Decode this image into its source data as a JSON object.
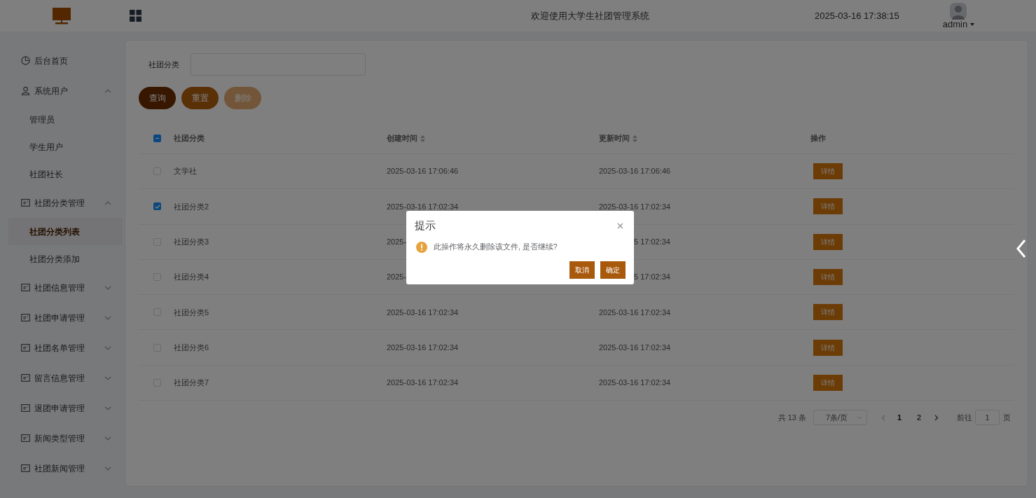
{
  "header": {
    "title": "欢迎使用大学生社团管理系统",
    "datetime": "2025-03-16 17:38:15",
    "user": "admin"
  },
  "sidebar": {
    "items": [
      {
        "label": "后台首页"
      },
      {
        "label": "系统用户",
        "expanded": true,
        "children": [
          {
            "label": "管理员",
            "selected": false
          },
          {
            "label": "学生用户",
            "selected": false
          },
          {
            "label": "社团社长",
            "selected": false
          }
        ]
      },
      {
        "label": "社团分类管理",
        "expanded": true,
        "children": [
          {
            "label": "社团分类列表",
            "selected": true
          },
          {
            "label": "社团分类添加",
            "selected": false
          }
        ]
      },
      {
        "label": "社团信息管理",
        "expanded": false
      },
      {
        "label": "社团申请管理",
        "expanded": false
      },
      {
        "label": "社团名单管理",
        "expanded": false
      },
      {
        "label": "留言信息管理",
        "expanded": false
      },
      {
        "label": "退团申请管理",
        "expanded": false
      },
      {
        "label": "新闻类型管理",
        "expanded": false
      },
      {
        "label": "社团新闻管理",
        "expanded": false
      }
    ]
  },
  "search": {
    "label": "社团分类"
  },
  "buttons": [
    {
      "label": "查询",
      "disabled": false
    },
    {
      "label": "重置",
      "disabled": false
    },
    {
      "label": "删除",
      "disabled": true
    }
  ],
  "table": {
    "select_all": {
      "indeterminate": true
    },
    "columns": [
      {
        "label": "社团分类",
        "sortable": false
      },
      {
        "label": "创建时间",
        "sortable": true
      },
      {
        "label": "更新时间",
        "sortable": true
      },
      {
        "label": "操作",
        "sortable": false
      }
    ],
    "rows": [
      {
        "selected": false,
        "name": "文学社",
        "created": "2025-03-16 17:06:46",
        "updated": "2025-03-16 17:06:46",
        "action": "详情"
      },
      {
        "selected": true,
        "name": "社团分类2",
        "created": "2025-03-16 17:02:34",
        "updated": "2025-03-16 17:02:34",
        "action": "详情"
      },
      {
        "selected": false,
        "name": "社团分类3",
        "created": "2025-",
        "updated": "5 17:02:34",
        "action": "详情"
      },
      {
        "selected": false,
        "name": "社团分类4",
        "created": "2025-",
        "updated": "5 17:02:34",
        "action": "详情"
      },
      {
        "selected": false,
        "name": "社团分类5",
        "created": "2025-03-16 17:02:34",
        "updated": "2025-03-16 17:02:34",
        "action": "详情"
      },
      {
        "selected": false,
        "name": "社团分类6",
        "created": "2025-03-16 17:02:34",
        "updated": "2025-03-16 17:02:34",
        "action": "详情"
      },
      {
        "selected": false,
        "name": "社团分类7",
        "created": "2025-03-16 17:02:34",
        "updated": "2025-03-16 17:02:34",
        "action": "详情"
      }
    ]
  },
  "pagination": {
    "total": "共 13 条",
    "page_size": "7条/页",
    "pages": [
      {
        "label": "1",
        "selected": true
      },
      {
        "label": "2",
        "selected": false
      }
    ],
    "goto_label": "前往",
    "goto_value": "1",
    "goto_suffix": "页"
  },
  "dialog": {
    "title": "提示",
    "message": "此操作将永久删除该文件, 是否继续?",
    "buttons": [
      "取消",
      "确定"
    ]
  }
}
